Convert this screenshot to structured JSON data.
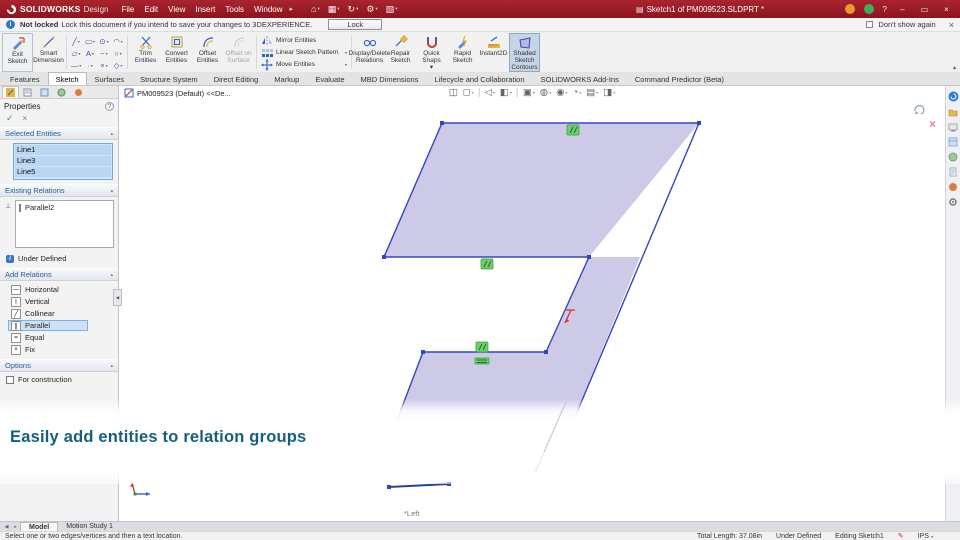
{
  "colors": {
    "titlebar_red": "#9a1a24",
    "sketch_fill": "#c9c6e5",
    "sketch_edge": "#3346c2",
    "relation_green": "#6fcf6f",
    "headline_blue": "#155e80",
    "selection_blue": "#cfe5fa"
  },
  "titlebar": {
    "app_name": "SOLIDWORKS",
    "app_edition": "Design",
    "menus": [
      "File",
      "Edit",
      "View",
      "Insert",
      "Tools",
      "Window"
    ],
    "document_title": "Sketch1 of PM009523.SLDPRT *",
    "help_label": "?",
    "window": {
      "minimize": "–",
      "maximize": "▭",
      "close": "×"
    }
  },
  "notifybar": {
    "status_bold": "Not locked",
    "message": "Lock this document if you intend to save your changes to 3DEXPERIENCE.",
    "lock_button": "Lock",
    "dismiss_label": "Don't show again",
    "close": "×"
  },
  "ribbon": {
    "buttons": {
      "exit_sketch": "Exit Sketch",
      "smart_dimension": "Smart Dimension",
      "trim_entities": "Trim Entities",
      "convert_entities": "Convert Entities",
      "offset_entities": "Offset Entities",
      "offset_on_surface": "Offset on Surface",
      "mirror_entities": "Mirror Entities",
      "linear_sketch_pattern": "Linear Sketch Pattern",
      "move_entities": "Move Entities",
      "display_delete_relations": "Display/Delete Relations",
      "repair_sketch": "Repair Sketch",
      "quick_snaps": "Quick Snaps",
      "rapid_sketch": "Rapid Sketch",
      "instant2d": "Instant2D",
      "shaded_sketch_contours": "Shaded Sketch Contours"
    },
    "tool_glyphs": [
      "╱",
      "▭",
      "⊙",
      "◠",
      "▱",
      "A",
      "~",
      "○",
      "—",
      "·",
      "×",
      "◇"
    ]
  },
  "command_tabs": [
    "Features",
    "Sketch",
    "Surfaces",
    "Structure System",
    "Direct Editing",
    "Markup",
    "Evaluate",
    "MBD Dimensions",
    "Lifecycle and Collaboration",
    "SOLIDWORKS Add-Ins",
    "Command Predictor (Beta)"
  ],
  "active_command_tab": "Sketch",
  "feature_breadcrumb": "PM009523 (Default) <<De...",
  "property_manager": {
    "title": "Properties",
    "ok_glyph": "✓",
    "cancel_glyph": "×",
    "help_glyph": "?",
    "sections": {
      "selected_entities": "Selected Entities",
      "existing_relations": "Existing Relations",
      "add_relations": "Add Relations",
      "options": "Options"
    },
    "selected_entities_items": [
      "Line1",
      "Line3",
      "Line5"
    ],
    "existing_relations_items": [
      "Parallel2"
    ],
    "existing_relations_glyph": "∥",
    "relations_filter_glyph": "⊥",
    "definition_status": "Under Defined",
    "add_relations_items": [
      "Horizontal",
      "Vertical",
      "Collinear",
      "Parallel",
      "Equal",
      "Fix"
    ],
    "add_relation_glyphs": [
      "—",
      "|",
      "╱",
      "∥",
      "=",
      "×"
    ],
    "add_relations_selected": "Parallel",
    "options_checkbox": "For construction"
  },
  "hud_glyphs": [
    "◫",
    "◻",
    "◁",
    "◧",
    "▣",
    "◍",
    "◉",
    "◔",
    "▤",
    "◨"
  ],
  "overlay": {
    "headline": "Easily add entities to relation groups"
  },
  "graphics": {
    "view_label": "*Left"
  },
  "bottom_tabs": [
    "Model",
    "Motion Study 1"
  ],
  "active_bottom_tab": "Model",
  "statusbar": {
    "hint": "Select one or two edges/vertices and then a text location.",
    "total_length": "Total Length: 37.08in",
    "definition_state": "Under Defined",
    "editing": "Editing Sketch1",
    "pencil_glyph": "✎",
    "units": "IPS"
  }
}
